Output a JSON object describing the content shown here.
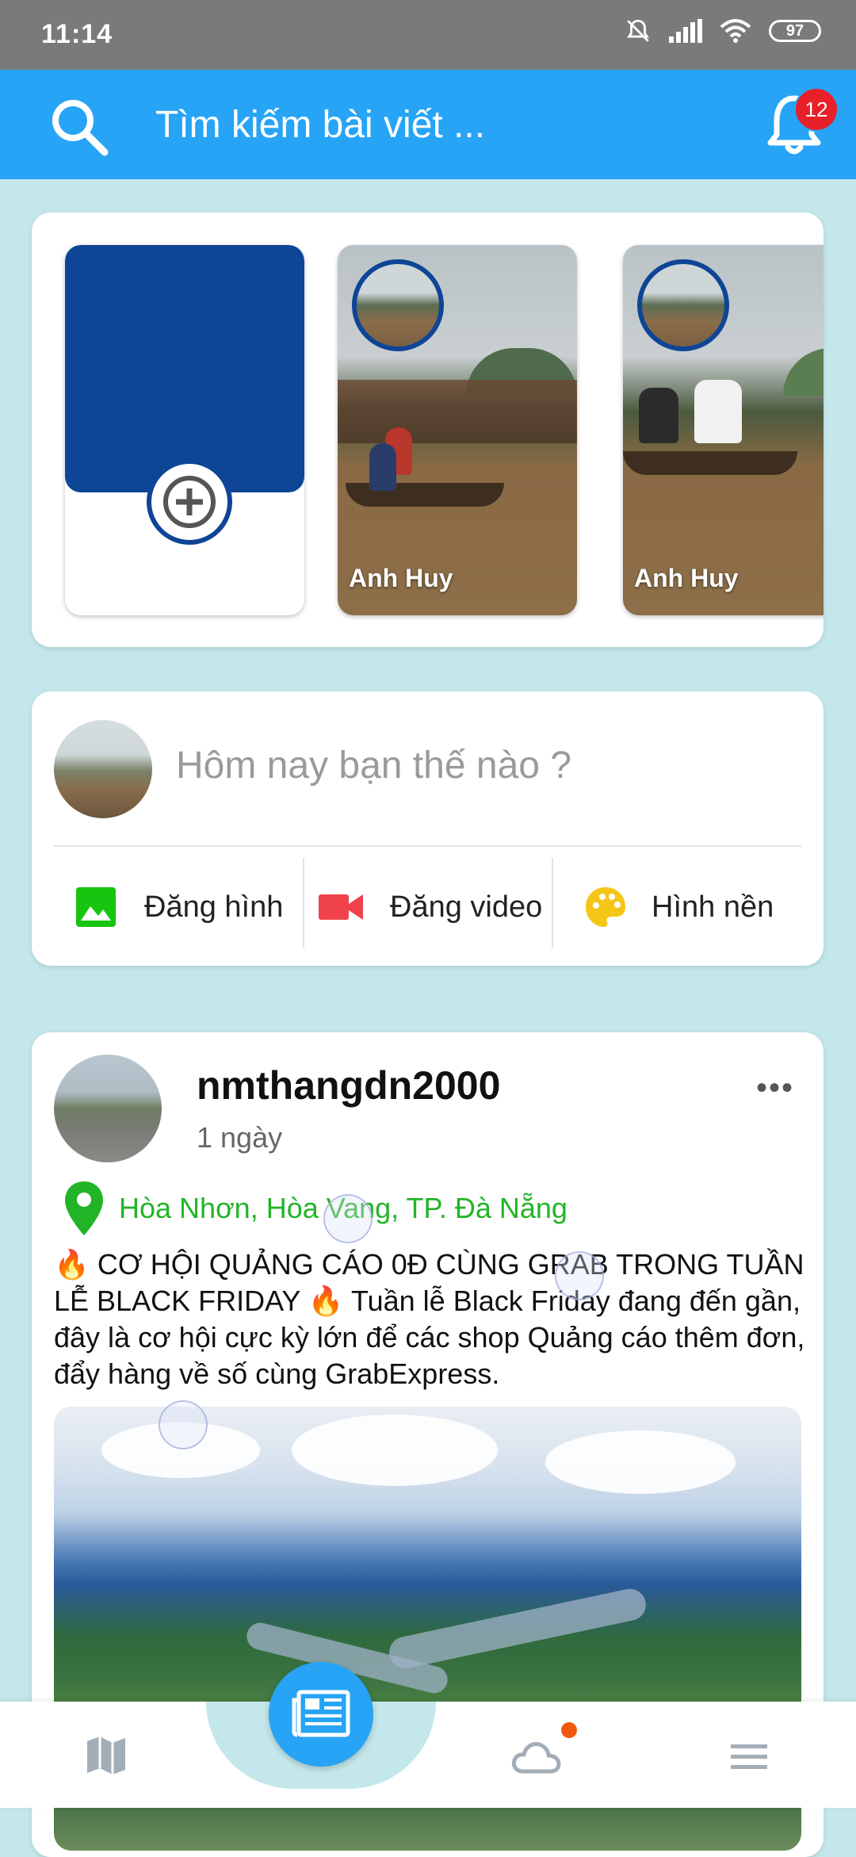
{
  "status_bar": {
    "time": "11:14",
    "battery": "97"
  },
  "header": {
    "search_placeholder": "Tìm kiếm bài viết ...",
    "notification_count": "12"
  },
  "stories": [
    {
      "name": ""
    },
    {
      "name": "Anh Huy"
    },
    {
      "name": "Anh Huy"
    }
  ],
  "composer": {
    "prompt": "Hôm nay bạn thế nào ?",
    "actions": [
      {
        "label": "Đăng hình",
        "icon": "image-icon",
        "color": "#17c40f"
      },
      {
        "label": "Đăng video",
        "icon": "video-camera-icon",
        "color": "#f0424b"
      },
      {
        "label": "Hình nền",
        "icon": "palette-icon",
        "color": "#f5c518"
      }
    ]
  },
  "post": {
    "username": "nmthangdn2000",
    "time": "1 ngày",
    "location": "Hòa Nhơn, Hòa Vang, TP. Đà Nẵng",
    "text": "🔥 CƠ HỘI QUẢNG CÁO 0Đ CÙNG GRAB TRONG TUẦN LỄ BLACK FRIDAY 🔥 Tuần lễ Black Friday đang đến gần, đây là cơ hội cực kỳ lớn để các shop Quảng cáo thêm đơn, đẩy hàng về số cùng GrabExpress.",
    "more_label": "•••"
  },
  "colors": {
    "primary": "#27a4f5",
    "story_blue": "#0e4596",
    "location_green": "#22b427",
    "badge_red": "#e8202a"
  }
}
